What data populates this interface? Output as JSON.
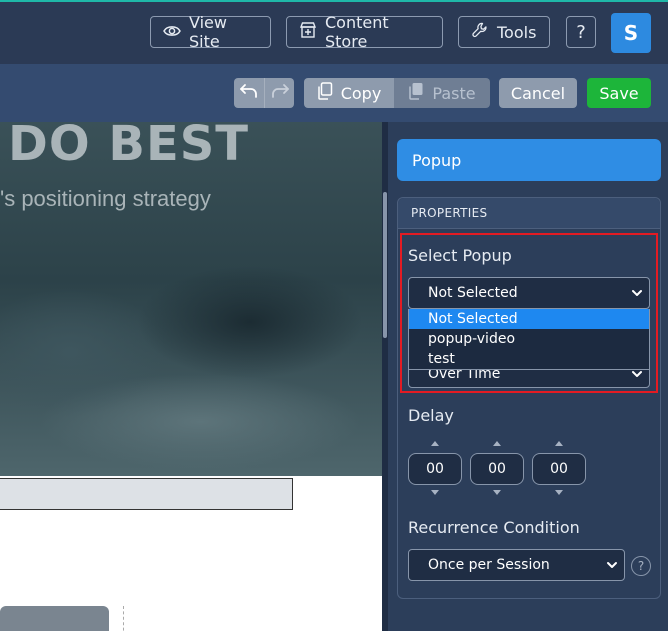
{
  "topbar": {
    "view_site_label": "View Site",
    "content_store_label": "Content Store",
    "tools_label": "Tools",
    "help_label": "?",
    "avatar_initial": "S"
  },
  "toolbar": {
    "copy_label": "Copy",
    "paste_label": "Paste",
    "cancel_label": "Cancel",
    "save_label": "Save"
  },
  "canvas": {
    "hero_title": "DO BEST",
    "hero_subtitle": "'s positioning strategy"
  },
  "panel": {
    "header": "Popup",
    "properties_title": "PROPERTIES",
    "select_popup_label": "Select Popup",
    "select_popup_value": "Not Selected",
    "popup_options": [
      "Not Selected",
      "popup-video",
      "test"
    ],
    "trigger_value": "Over Time",
    "delay_label": "Delay",
    "delay_values": [
      "00",
      "00",
      "00"
    ],
    "recurrence_label": "Recurrence Condition",
    "recurrence_value": "Once per Session",
    "help_icon_glyph": "?"
  },
  "colors": {
    "accent": "#2f8de4",
    "save": "#1db53a",
    "highlight": "#e31b23",
    "topbar": "#2b3a55",
    "toolbar": "#344b70"
  },
  "icons": [
    "eye-icon",
    "store-icon",
    "wrench-icon",
    "undo-icon",
    "redo-icon",
    "copy-icon",
    "paste-icon",
    "chevron-down-icon",
    "help-icon"
  ]
}
